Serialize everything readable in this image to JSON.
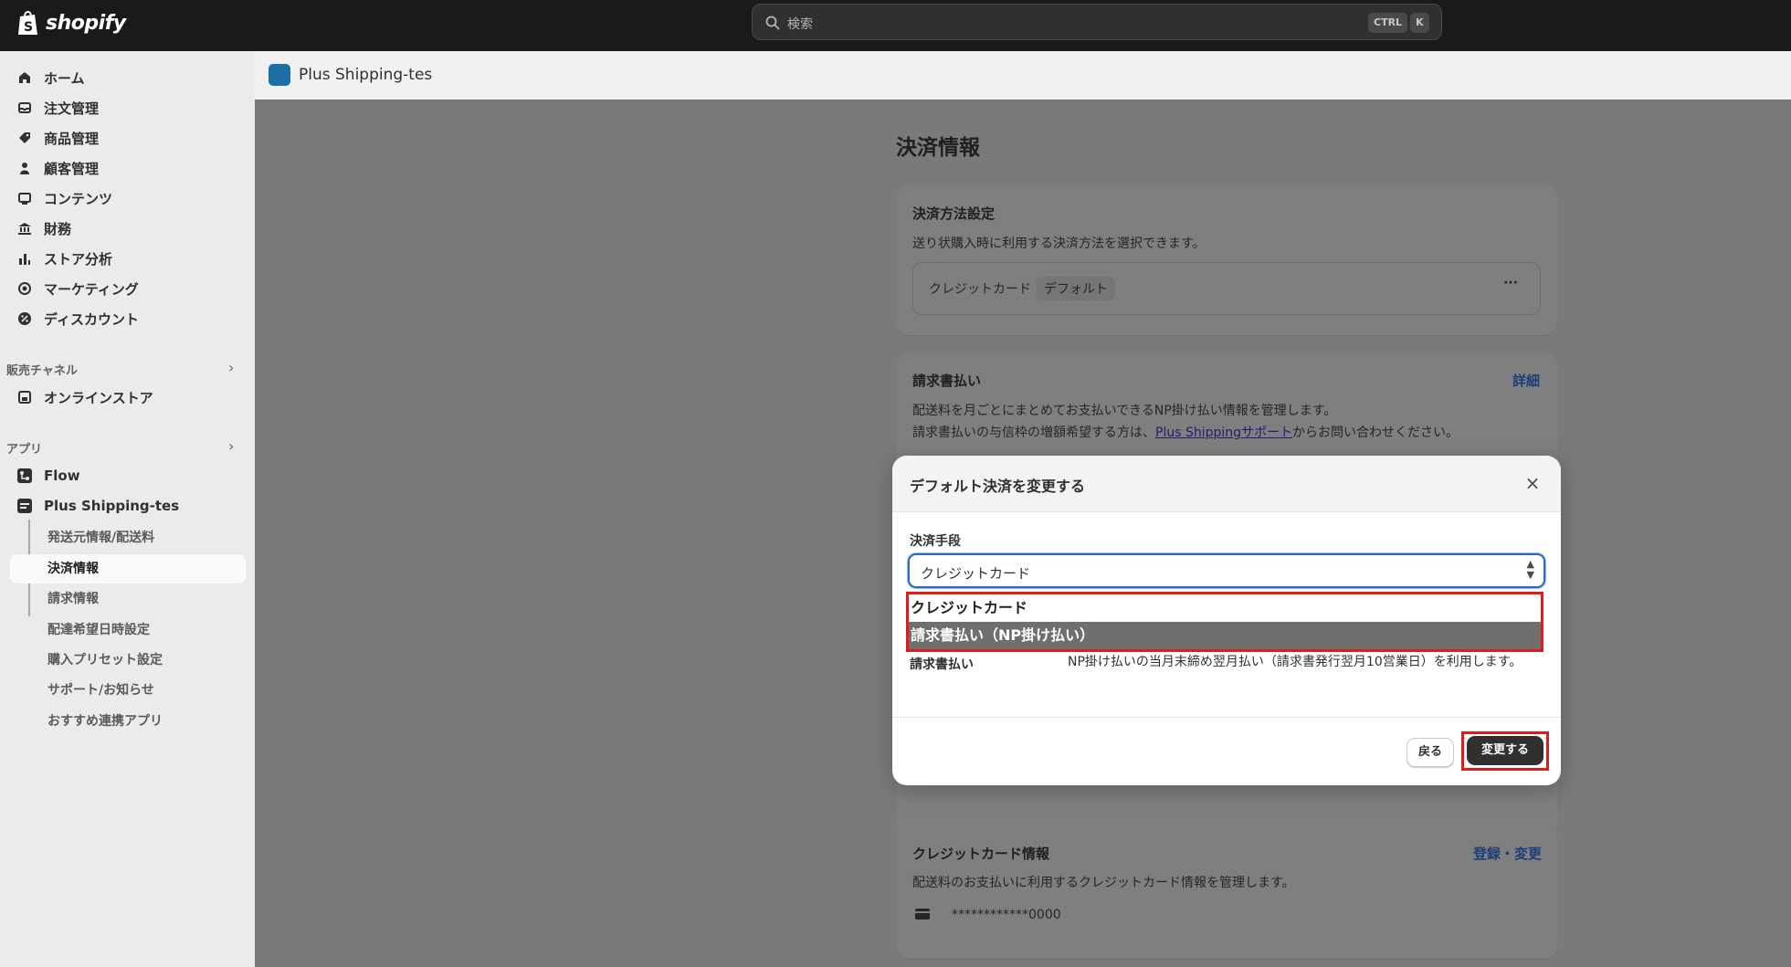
{
  "topbar": {
    "brand": "shopify",
    "search_placeholder": "検索",
    "shortcut_ctrl": "CTRL",
    "shortcut_k": "K"
  },
  "sidebar": {
    "items": [
      {
        "label": "ホーム",
        "icon": "home-icon"
      },
      {
        "label": "注文管理",
        "icon": "inbox-icon"
      },
      {
        "label": "商品管理",
        "icon": "tag-icon"
      },
      {
        "label": "顧客管理",
        "icon": "person-icon"
      },
      {
        "label": "コンテンツ",
        "icon": "content-icon"
      },
      {
        "label": "財務",
        "icon": "bank-icon"
      },
      {
        "label": "ストア分析",
        "icon": "bar-chart-icon"
      },
      {
        "label": "マーケティング",
        "icon": "target-icon"
      },
      {
        "label": "ディスカウント",
        "icon": "discount-icon"
      }
    ],
    "sales_channels_label": "販売チャネル",
    "online_store": "オンラインストア",
    "apps_label": "アプリ",
    "flow": "Flow",
    "plus_app": "Plus Shipping-tes",
    "sub_items": [
      "発送元情報/配送料",
      "決済情報",
      "請求情報",
      "配達希望日時設定",
      "購入プリセット設定",
      "サポート/お知らせ",
      "おすすめ連携アプリ"
    ]
  },
  "appbar": {
    "app_name": "Plus Shipping-tes"
  },
  "page": {
    "title": "決済情報",
    "payment_settings": {
      "title": "決済方法設定",
      "desc": "送り状購入時に利用する決済方法を選択できます。",
      "method": "クレジットカード",
      "badge": "デフォルト",
      "more": "···"
    },
    "invoice": {
      "title": "請求書払い",
      "link": "詳細",
      "desc1": "配送料を月ごとにまとめてお支払いできるNP掛け払い情報を管理します。",
      "desc2_pre": "請求書払いの与信枠の増額希望する方は、",
      "desc2_link": "Plus Shippingサポート",
      "desc2_post": "からお問い合わせください。"
    },
    "credit_card": {
      "title": "クレジットカード情報",
      "link": "登録・変更",
      "desc": "配送料のお支払いに利用するクレジットカード情報を管理します。",
      "number": "************0000"
    }
  },
  "modal": {
    "title": "デフォルト決済を変更する",
    "close": "×",
    "field_label": "決済手段",
    "selected": "クレジットカード",
    "options": [
      "クレジットカード",
      "請求書払い（NP掛け払い）"
    ],
    "row_label": "請求書払い",
    "row_text": "NP掛け払いの当月末締め翌月払い（請求書発行翌月10営業日）を利用します。",
    "back": "戻る",
    "confirm": "変更する"
  }
}
